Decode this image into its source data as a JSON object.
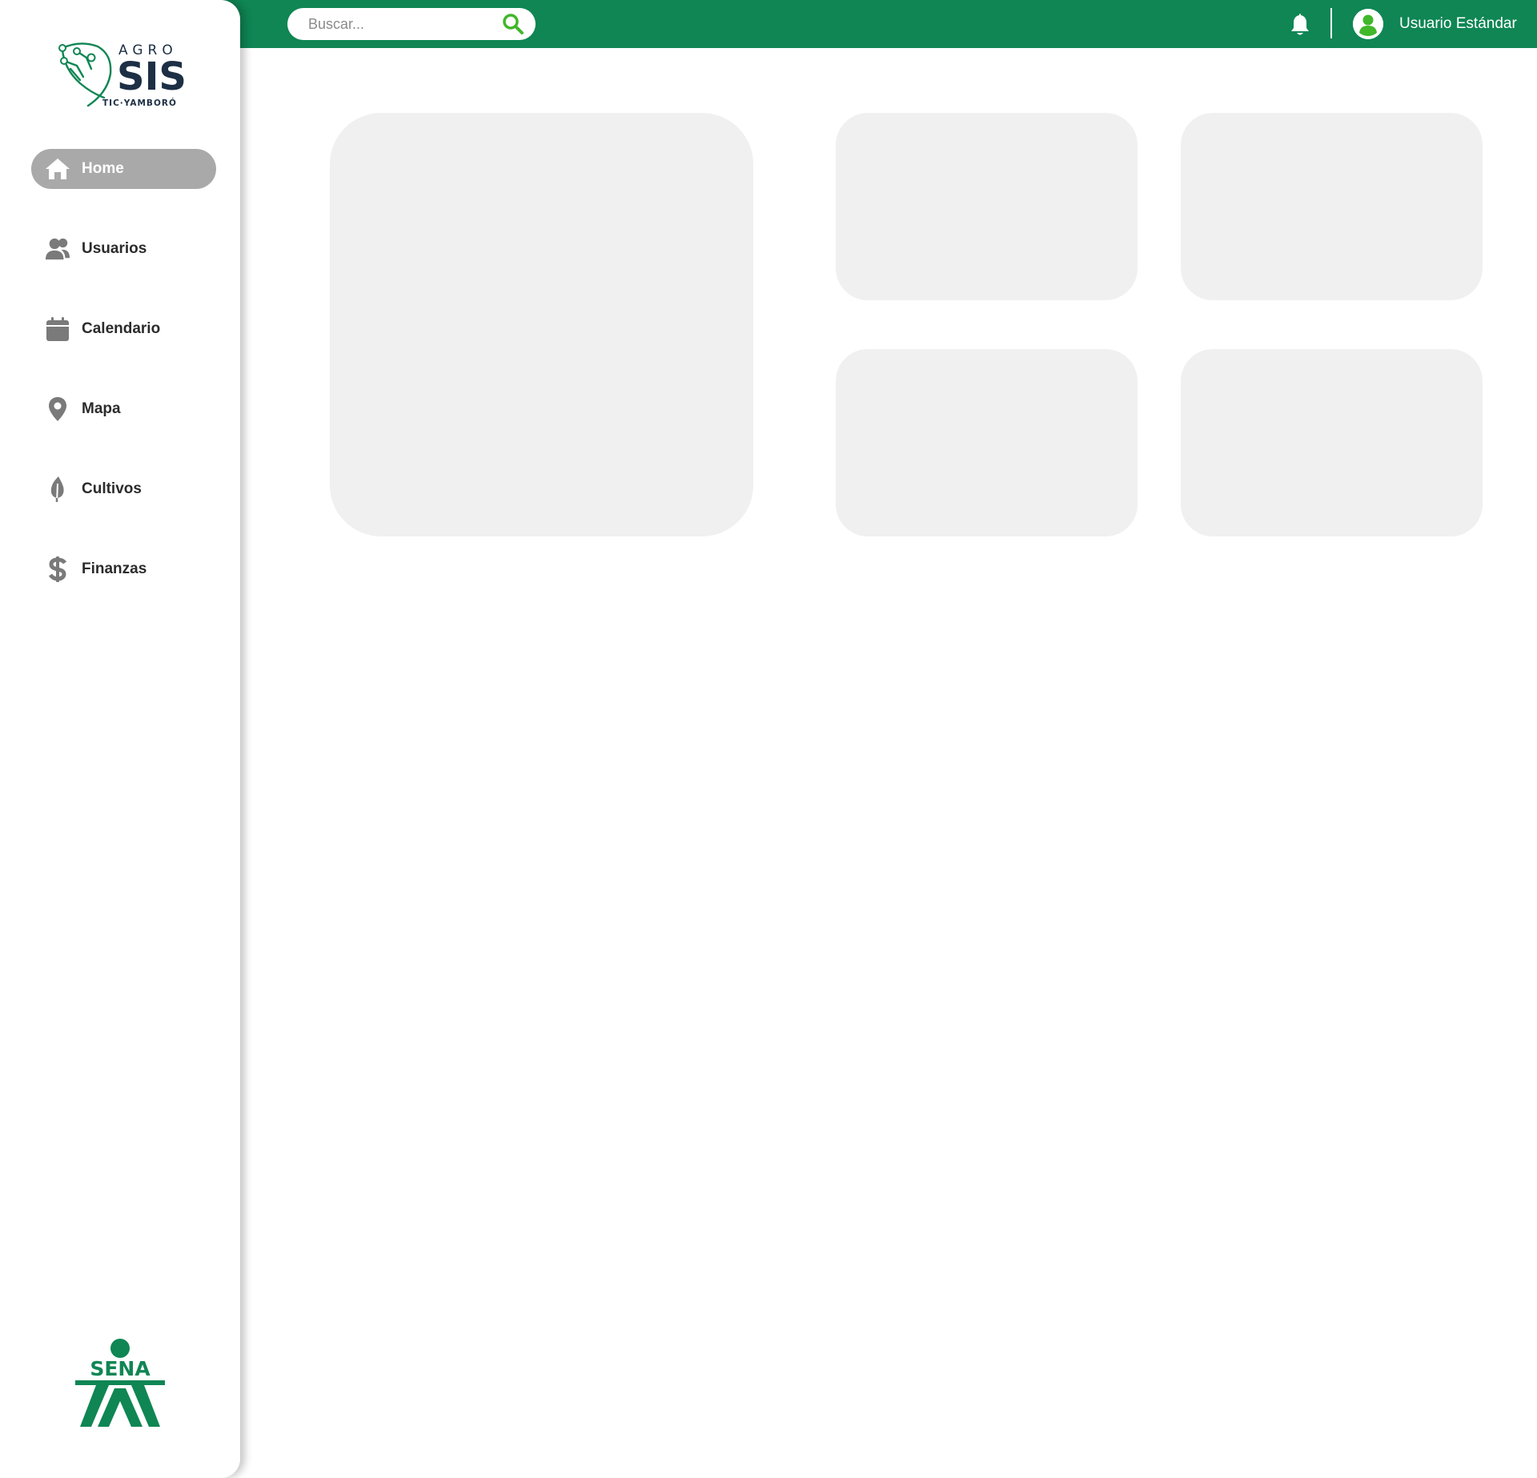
{
  "app": {
    "logo_text": {
      "top": "AGRO",
      "main": "SIS",
      "sub": "TIC·YAMBORÓ"
    },
    "footer_logo_text": "SENA"
  },
  "colors": {
    "brand_green": "#0f8654",
    "icon_green": "#41b72a",
    "logo_navy": "#1d2f45",
    "active_nav": "#a9a9a9",
    "card_bg": "#f0f0f0",
    "nav_icon_gray": "#7a7a7a"
  },
  "search": {
    "placeholder": "Buscar...",
    "value": "",
    "icon": "search-icon"
  },
  "header": {
    "notification_icon": "bell-icon",
    "user_icon": "user-circle-icon",
    "user_name": "Usuario Estándar"
  },
  "sidebar": {
    "items": [
      {
        "label": "Home",
        "icon": "home-icon",
        "active": true
      },
      {
        "label": "Usuarios",
        "icon": "users-icon",
        "active": false
      },
      {
        "label": "Calendario",
        "icon": "calendar-icon",
        "active": false
      },
      {
        "label": "Mapa",
        "icon": "map-pin-icon",
        "active": false
      },
      {
        "label": "Cultivos",
        "icon": "leaf-icon",
        "active": false
      },
      {
        "label": "Finanzas",
        "icon": "dollar-icon",
        "active": false
      }
    ]
  }
}
